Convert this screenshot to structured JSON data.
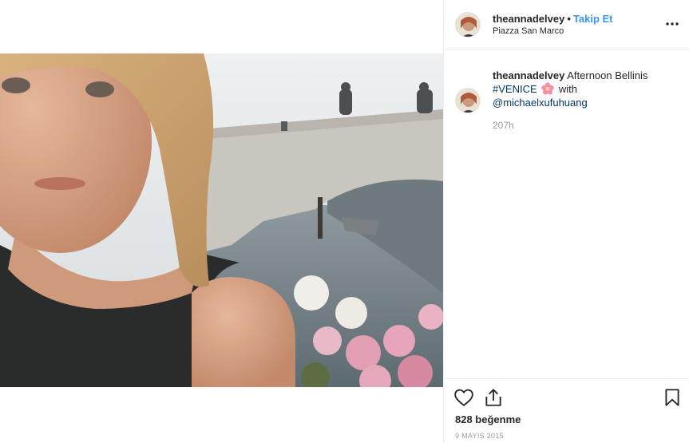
{
  "post": {
    "username": "theannadelvey",
    "separator": "•",
    "follow_label": "Takip Et",
    "location": "Piazza San Marco",
    "more_label": "•••",
    "caption": {
      "username": "theannadelvey",
      "text_part1": "Afternoon Bellinis",
      "hashtag": "#VENICE",
      "text_part2": "with",
      "mention": "@michaelxufuhuang"
    },
    "time_ago": "207h",
    "likes": "828 beğenme",
    "date": "9 MAYIS 2015"
  },
  "icons": {
    "more": "ellipsis-icon",
    "like": "heart-icon",
    "share": "share-icon",
    "save": "bookmark-icon",
    "emoji": "flower-emoji-icon"
  },
  "colors": {
    "follow": "#3897f0",
    "link": "#003569",
    "muted": "#999999",
    "text": "#262626",
    "border": "#efefef"
  }
}
